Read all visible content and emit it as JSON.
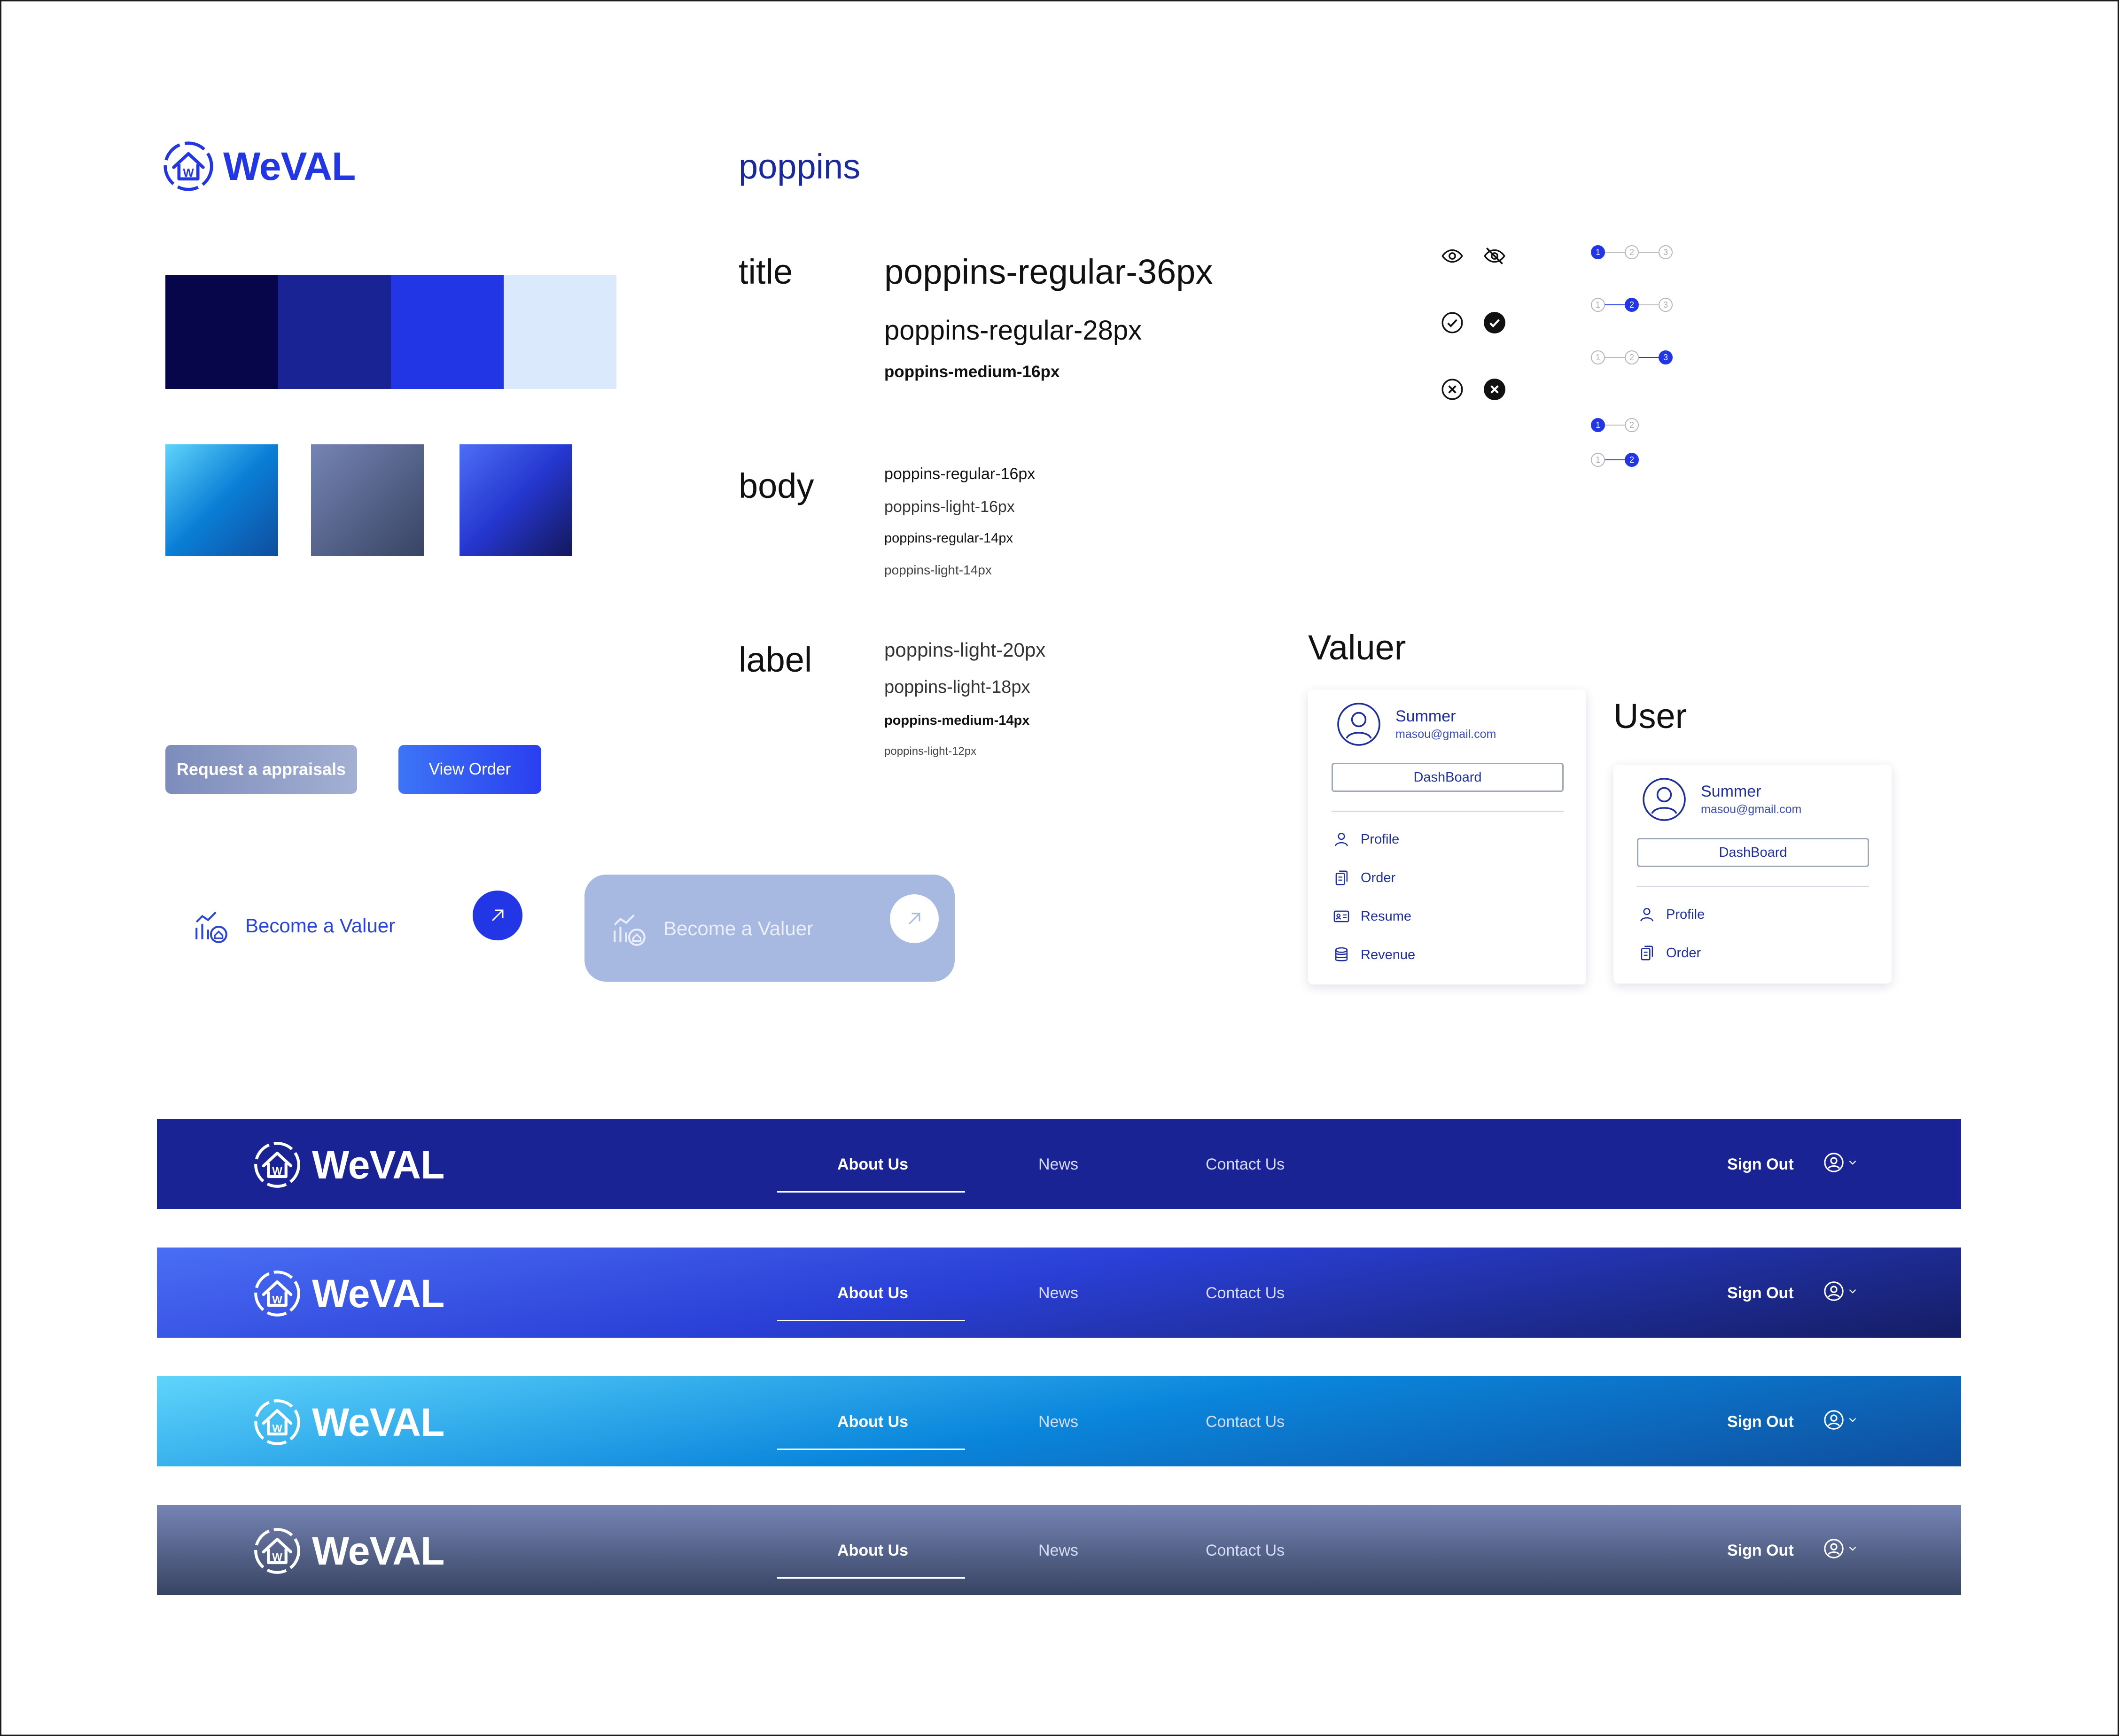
{
  "brand": {
    "name": "WeVAL",
    "primary": "#2236e6"
  },
  "palette": {
    "solids": [
      "#07064a",
      "#1a2394",
      "#2236e6",
      "#dbe9fc"
    ],
    "gradients": [
      [
        "#5fd4fb",
        "#0a7ed6",
        "#0f4d9e"
      ],
      [
        "#7584b4",
        "#384463"
      ],
      [
        "#4d6ef6",
        "#2536cf",
        "#14185a"
      ]
    ]
  },
  "typography": {
    "family": "poppins",
    "title": {
      "label": "title",
      "samples": [
        "poppins-regular-36px",
        "poppins-regular-28px",
        "poppins-medium-16px"
      ]
    },
    "body": {
      "label": "body",
      "samples": [
        "poppins-regular-16px",
        "poppins-light-16px",
        "poppins-regular-14px",
        "poppins-light-14px"
      ]
    },
    "label": {
      "label": "label",
      "samples": [
        "poppins-light-20px",
        "poppins-light-18px",
        "poppins-medium-14px",
        "poppins-light-12px"
      ]
    }
  },
  "icons": [
    "eye-icon",
    "eye-off-icon",
    "check-circle-outline-icon",
    "check-circle-filled-icon",
    "x-circle-outline-icon",
    "x-circle-filled-icon"
  ],
  "steppers": {
    "three_step": [
      [
        "1",
        "2",
        "3"
      ],
      [
        "1",
        "2",
        "3"
      ],
      [
        "1",
        "2",
        "3"
      ]
    ],
    "two_step": [
      [
        "1",
        "2"
      ],
      [
        "1",
        "2"
      ]
    ]
  },
  "buttons": {
    "request": "Request a appraisals",
    "view_order": "View Order",
    "become_valuer": "Become a Valuer",
    "become_valuer_disabled": "Become a Valuer"
  },
  "menus": {
    "valuer": {
      "title": "Valuer",
      "name": "Summer",
      "email": "masou@gmail.com",
      "dashboard": "DashBoard",
      "items": [
        "Profile",
        "Order",
        "Resume",
        "Revenue"
      ]
    },
    "user": {
      "title": "User",
      "name": "Summer",
      "email": "masou@gmail.com",
      "dashboard": "DashBoard",
      "items": [
        "Profile",
        "Order"
      ]
    }
  },
  "navbar": {
    "brand": "WeVAL",
    "links": [
      "About Us",
      "News",
      "Contact Us"
    ],
    "sign_out": "Sign Out",
    "variants": [
      {
        "bg": "#1a2394"
      },
      {
        "bg": "linear-gradient(170deg, #4a6ef5 0%, #2a3fd6 45%, #151d63 100%)"
      },
      {
        "bg": "linear-gradient(170deg, #5fd4fb 0%, #0a86dc 50%, #0f4d9e 100%)"
      },
      {
        "bg": "linear-gradient(180deg, #7584b4 0%, #384463 100%)"
      }
    ]
  }
}
